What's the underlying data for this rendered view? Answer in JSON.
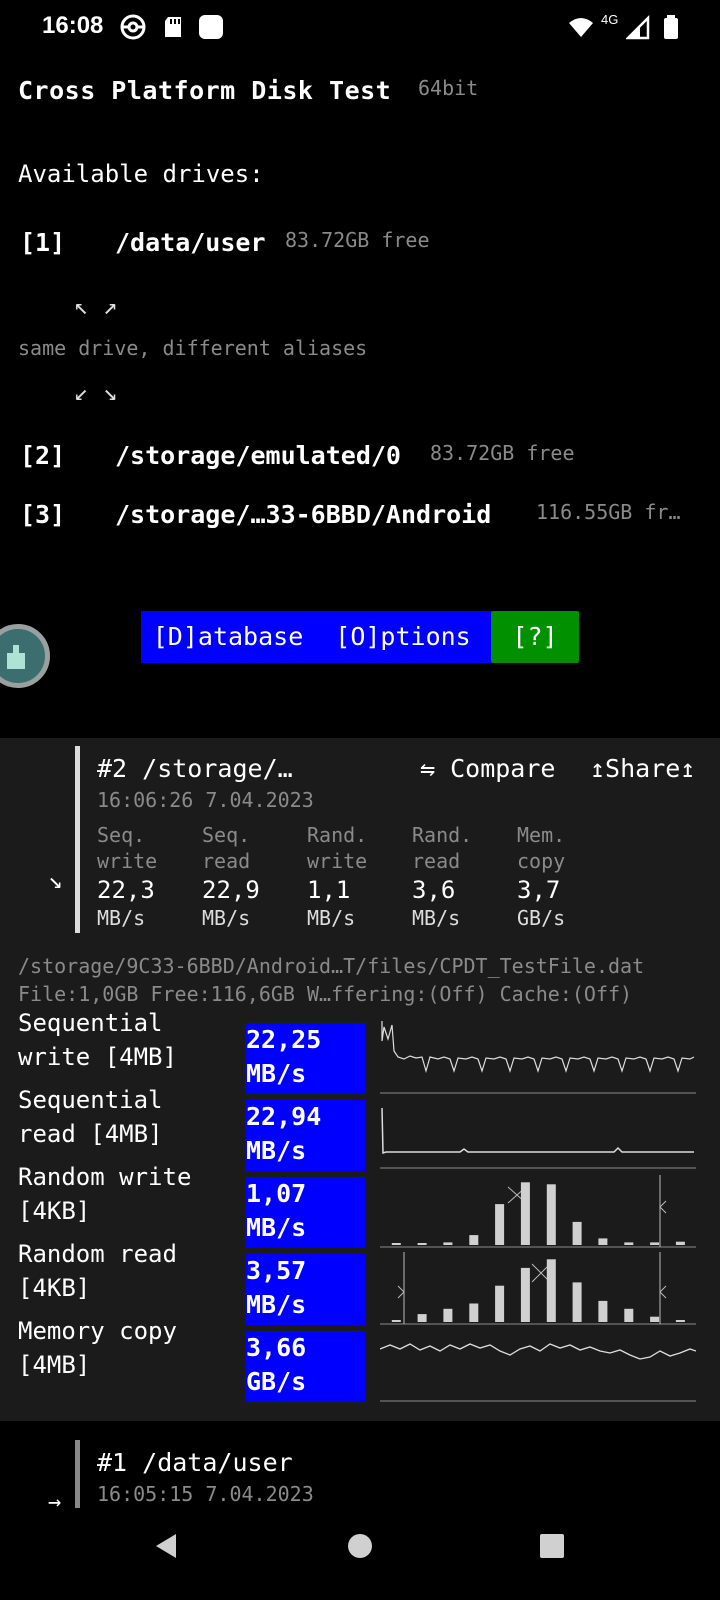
{
  "status_bar": {
    "time": "16:08",
    "network_label": "4G",
    "icons": [
      "pokeball-icon",
      "sd-card-icon",
      "app-square-icon",
      "wifi-icon",
      "signal-icon",
      "battery-icon"
    ]
  },
  "header": {
    "title": "Cross Platform Disk Test",
    "arch": "64bit",
    "drives_label": "Available drives:"
  },
  "drives": [
    {
      "index": "[1]",
      "path": "/data/user",
      "free": "83.72GB free"
    },
    {
      "index": "[2]",
      "path": "/storage/emulated/0",
      "free": "83.72GB free"
    },
    {
      "index": "[3]",
      "path": "/storage/…33-6BBD/Android",
      "free": "116.55GB fr…"
    }
  ],
  "alias": {
    "arrows_top": "↖ ↗",
    "note": "same drive, different aliases",
    "arrows_bottom": "↙ ↘"
  },
  "buttons": {
    "database": "[D]atabase",
    "options": "[O]ptions",
    "help": "[?]"
  },
  "colors": {
    "accent_blue": "#0000ff",
    "help_green": "#009000",
    "panel_bg": "#1b1b1b"
  },
  "result2": {
    "expand_arrow": "↘",
    "title": "#2 /storage/…",
    "compare": "⇋ Compare",
    "share": "↥Share↥",
    "timestamp": "16:06:26 7.04.2023",
    "stats": [
      {
        "l1": "Seq.",
        "l2": "write",
        "value": "22,3",
        "unit": "MB/s"
      },
      {
        "l1": "Seq.",
        "l2": "read",
        "value": "22,9",
        "unit": "MB/s"
      },
      {
        "l1": "Rand.",
        "l2": "write",
        "value": "1,1",
        "unit": "MB/s"
      },
      {
        "l1": "Rand.",
        "l2": "read",
        "value": "3,6",
        "unit": "MB/s"
      },
      {
        "l1": "Mem.",
        "l2": "copy",
        "value": "3,7",
        "unit": "GB/s"
      }
    ],
    "path_line": "/storage/9C33-6BBD/Android…T/files/CPDT_TestFile.dat",
    "info_line": "File:1,0GB Free:116,6GB W…ffering:(Off) Cache:(Off)",
    "rows": [
      {
        "l1": "Sequential",
        "l2": "write [4MB]",
        "value": "22,25",
        "unit": "MB/s",
        "chart": "seq-write-throughput-chart"
      },
      {
        "l1": "Sequential",
        "l2": "read [4MB]",
        "value": "22,94",
        "unit": "MB/s",
        "chart": "seq-read-throughput-chart"
      },
      {
        "l1": "Random write",
        "l2": "[4KB]",
        "value": "1,07",
        "unit": "MB/s",
        "chart": "rand-write-histogram-chart"
      },
      {
        "l1": "Random read",
        "l2": "[4KB]",
        "value": "3,57",
        "unit": "MB/s",
        "chart": "rand-read-histogram-chart"
      },
      {
        "l1": "Memory copy",
        "l2": "[4MB]",
        "value": "3,66",
        "unit": "GB/s",
        "chart": "mem-copy-throughput-chart"
      }
    ]
  },
  "result1": {
    "expand_arrow": "→",
    "title": "#1 /data/user",
    "timestamp": "16:05:15 7.04.2023"
  },
  "nav": {
    "icons": [
      "back-icon",
      "home-icon",
      "recents-icon"
    ]
  },
  "chart_data": [
    {
      "type": "histogram",
      "name": "Random write",
      "values": [
        0.02,
        0.02,
        0.04,
        0.15,
        0.62,
        0.95,
        0.92,
        0.35,
        0.1,
        0.04,
        0.04,
        0.05
      ]
    },
    {
      "type": "histogram",
      "name": "Random read",
      "values": [
        0.02,
        0.12,
        0.2,
        0.28,
        0.55,
        0.82,
        0.95,
        0.6,
        0.32,
        0.2,
        0.08,
        0.02
      ]
    }
  ]
}
